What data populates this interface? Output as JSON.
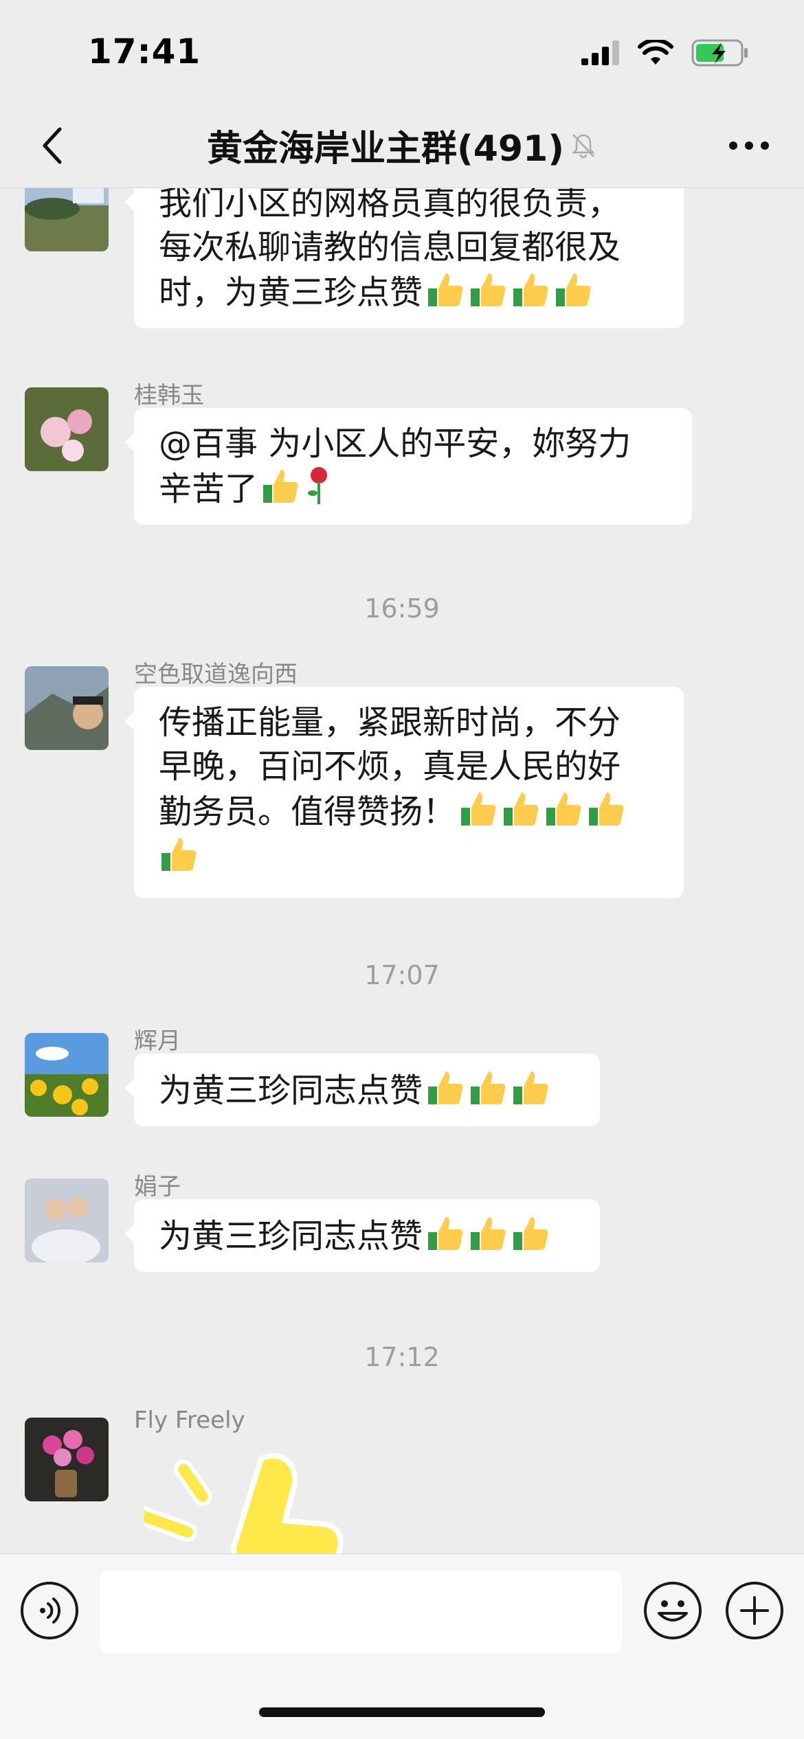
{
  "status": {
    "time": "17:41"
  },
  "nav": {
    "title": "黄金海岸业主群(491)"
  },
  "messages": [
    {
      "sender": "",
      "text": "我们小区的网格员真的很负责，每次私聊请教的信息回复都很及时，为黄三珍点赞",
      "emojis": [
        "thumbs-up",
        "thumbs-up",
        "thumbs-up",
        "thumbs-up"
      ]
    },
    {
      "sender": "桂韩玉",
      "text": "@百事 为小区人的平安，妳努力辛苦了",
      "emojis": [
        "thumbs-up",
        "rose"
      ]
    },
    {
      "timestamp": "16:59"
    },
    {
      "sender": "空色取道逸向西",
      "text": "传播正能量，紧跟新时尚，不分早晚，百问不烦，真是人民的好勤务员。值得赞扬！",
      "emojis": [
        "thumbs-up",
        "thumbs-up",
        "thumbs-up",
        "thumbs-up",
        "thumbs-up"
      ]
    },
    {
      "timestamp": "17:07"
    },
    {
      "sender": "辉月",
      "text": "为黄三珍同志点赞",
      "emojis": [
        "thumbs-up",
        "thumbs-up",
        "thumbs-up"
      ]
    },
    {
      "sender": "娟子",
      "text": "为黄三珍同志点赞",
      "emojis": [
        "thumbs-up",
        "thumbs-up",
        "thumbs-up"
      ]
    },
    {
      "timestamp": "17:12"
    },
    {
      "sender": "Fly Freely",
      "sticker": "thumbs-up-sticker"
    }
  ],
  "chat": {
    "m1": {
      "line1": "我们小区的网格员真的很负责，",
      "line2": "每次私聊请教的信息回复都很及",
      "line3": "时，为黄三珍点赞"
    },
    "m2": {
      "sender": "桂韩玉",
      "line1": "@百事 为小区人的平安，妳努力",
      "line2": "辛苦了"
    },
    "ts1": "16:59",
    "m3": {
      "sender": "空色取道逸向西",
      "line1": "传播正能量，紧跟新时尚，不分",
      "line2": "早晚，百问不烦，真是人民的好",
      "line3": "勤务员。值得赞扬！"
    },
    "ts2": "17:07",
    "m4": {
      "sender": "辉月",
      "text": "为黄三珍同志点赞"
    },
    "m5": {
      "sender": "娟子",
      "text": "为黄三珍同志点赞"
    },
    "ts3": "17:12",
    "m6": {
      "sender": "Fly Freely"
    }
  },
  "input": {
    "placeholder": ""
  },
  "icons": {
    "back": "chevron-left-icon",
    "mute": "bell-slash-icon",
    "more": "more-dots-icon",
    "voice": "voice-icon",
    "emoji": "smiley-icon",
    "plus": "plus-icon"
  },
  "colors": {
    "background": "#ededed",
    "bubble": "#ffffff",
    "timestamp": "#9d9d9d",
    "battery": "#34c759"
  }
}
